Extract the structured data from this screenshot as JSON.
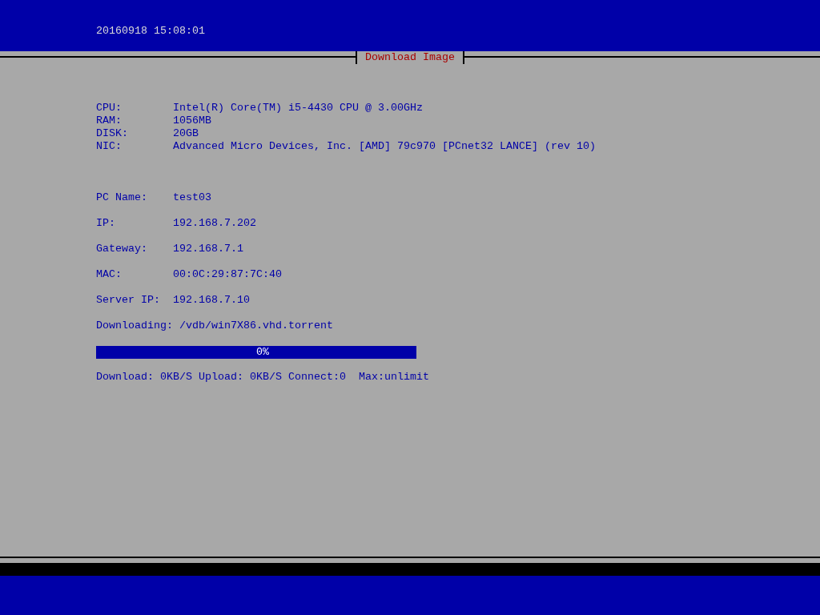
{
  "header": {
    "timestamp": "20160918 15:08:01"
  },
  "panel": {
    "title": "Download Image"
  },
  "hardware": [
    {
      "label": "CPU:",
      "value": "Intel(R) Core(TM) i5-4430 CPU @ 3.00GHz"
    },
    {
      "label": "RAM:",
      "value": "1056MB"
    },
    {
      "label": "DISK:",
      "value": "20GB"
    },
    {
      "label": "NIC:",
      "value": "Advanced Micro Devices, Inc. [AMD] 79c970 [PCnet32 LANCE] (rev 10)"
    }
  ],
  "network": [
    {
      "label": "PC Name:",
      "value": "test03"
    },
    {
      "label": "IP:",
      "value": "192.168.7.202"
    },
    {
      "label": "Gateway:",
      "value": "192.168.7.1"
    },
    {
      "label": "MAC:",
      "value": "00:0C:29:87:7C:40"
    },
    {
      "label": "Server IP:",
      "value": "192.168.7.10"
    }
  ],
  "downloading": {
    "label": "Downloading:",
    "value": "/vdb/win7X86.vhd.torrent"
  },
  "progress": {
    "level": 0,
    "text": "0%"
  },
  "stats": "Download: 0KB/S Upload: 0KB/S Connect:0  Max:unlimit"
}
